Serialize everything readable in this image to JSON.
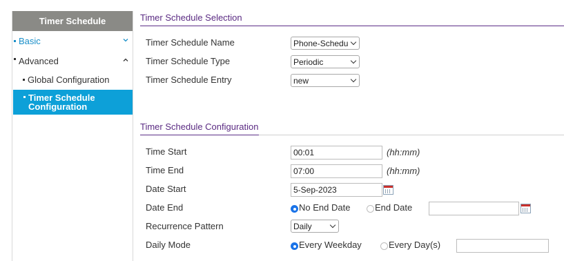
{
  "sidebar": {
    "title": "Timer Schedule",
    "items": [
      {
        "label": "Basic"
      },
      {
        "label": "Advanced"
      },
      {
        "label": "Global Configuration"
      },
      {
        "label_line1": "Timer Schedule",
        "label_line2": "Configuration"
      }
    ]
  },
  "selection": {
    "title": "Timer Schedule Selection",
    "name_label": "Timer Schedule Name",
    "name_value": "Phone-Schedule",
    "type_label": "Timer Schedule Type",
    "type_value": "Periodic",
    "entry_label": "Timer Schedule Entry",
    "entry_value": "new"
  },
  "configuration": {
    "title": "Timer Schedule Configuration",
    "time_start_label": "Time Start",
    "time_start_value": "00:01",
    "time_start_unit": "(hh:mm)",
    "time_end_label": "Time End",
    "time_end_value": "07:00",
    "time_end_unit": "(hh:mm)",
    "date_start_label": "Date Start",
    "date_start_value": "5-Sep-2023",
    "date_end_label": "Date End",
    "no_end_date_label": "No End Date",
    "end_date_label": "End Date",
    "end_date_value": "",
    "recurrence_label": "Recurrence Pattern",
    "recurrence_value": "Daily",
    "daily_mode_label": "Daily Mode",
    "every_weekday_label": "Every Weekday",
    "every_days_label": "Every Day(s)",
    "every_days_value": ""
  },
  "icons": {
    "calendar": "calendar-icon",
    "chevron_down": "chevron-down-icon",
    "chevron_up": "chevron-up-icon"
  },
  "colors": {
    "accent": "#0da0d8",
    "section_title": "#5a2a82",
    "sidebar_header": "#8a8a86",
    "radio_selected": "#1a73e8"
  }
}
